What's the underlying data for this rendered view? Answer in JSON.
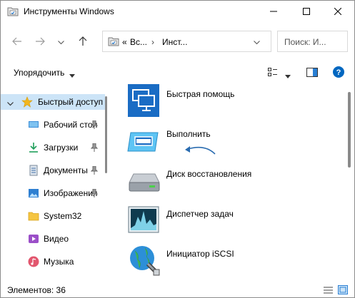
{
  "window": {
    "title": "Инструменты Windows"
  },
  "address": {
    "overflow": "«",
    "segments": [
      "Вс...",
      "Инст..."
    ]
  },
  "search": {
    "placeholder": "Поиск: И..."
  },
  "command_bar": {
    "sort_label": "Упорядочить"
  },
  "nav": {
    "items": [
      {
        "label": "Быстрый доступ",
        "icon": "star-icon",
        "selected": true,
        "pinned": false
      },
      {
        "label": "Рабочий стол",
        "icon": "desktop-icon",
        "pinned": true
      },
      {
        "label": "Загрузки",
        "icon": "download-icon",
        "pinned": true
      },
      {
        "label": "Документы",
        "icon": "documents-icon",
        "pinned": true
      },
      {
        "label": "Изображения",
        "icon": "pictures-icon",
        "pinned": true
      },
      {
        "label": "System32",
        "icon": "folder-icon",
        "pinned": false
      },
      {
        "label": "Видео",
        "icon": "videos-icon",
        "pinned": false
      },
      {
        "label": "Музыка",
        "icon": "music-icon",
        "pinned": false
      }
    ]
  },
  "files": [
    {
      "label": "Быстрая помощь",
      "icon": "quick-assist-icon"
    },
    {
      "label": "Выполнить",
      "icon": "run-icon"
    },
    {
      "label": "Диск восстановления",
      "icon": "recovery-drive-icon"
    },
    {
      "label": "Диспетчер задач",
      "icon": "task-manager-icon"
    },
    {
      "label": "Инициатор iSCSI",
      "icon": "iscsi-icon"
    }
  ],
  "status": {
    "items_count": "Элементов: 36"
  },
  "colors": {
    "accent": "#0067c0",
    "selection": "#cce4f7",
    "help": "#0067c0"
  }
}
